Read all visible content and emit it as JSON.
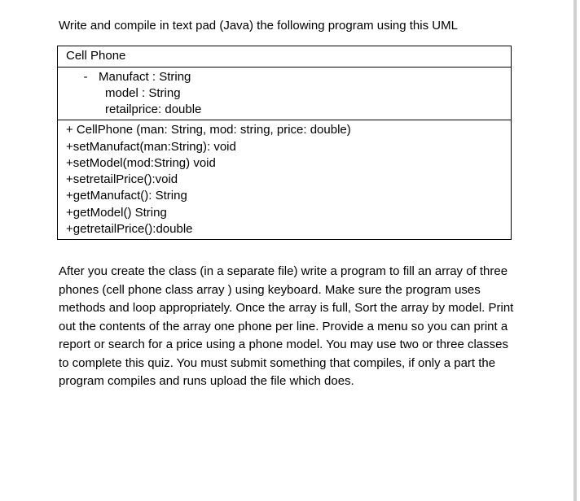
{
  "intro": "Write and compile in text pad (Java)  the following program using this UML",
  "uml": {
    "className": "Cell Phone",
    "fields": {
      "dash": "-",
      "f1": "Manufact : String",
      "f2": "model :  String",
      "f3": "retailprice:  double"
    },
    "methods": {
      "m1": "+ CellPhone (man: String, mod: string, price: double)",
      "m2": "+setManufact(man:String): void",
      "m3": "+setModel(mod:String) void",
      "m4": "+setretailPrice():void",
      "m5": "+getManufact(): String",
      "m6": "+getModel() String",
      "m7": "+getretailPrice():double"
    }
  },
  "instructions": "After you create the class (in a separate file) write a program to fill an array of three phones (cell phone class array ) using keyboard.  Make sure the program uses methods and loop appropriately.  Once the array is full, Sort the array by model. Print out the contents of the array one phone per line.  Provide a menu so you can print a report or search for a price using a phone model. You may use two or three classes to complete this quiz. You must submit something that compiles, if only a part the program compiles and runs upload the file which does."
}
